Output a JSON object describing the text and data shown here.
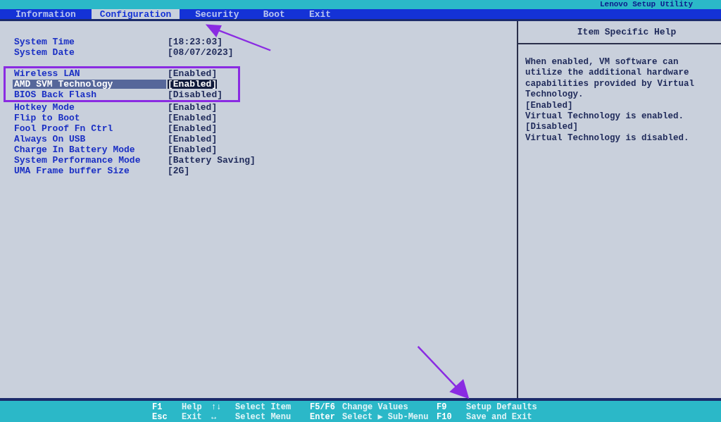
{
  "window": {
    "title": "Lenovo Setup Utility"
  },
  "tabs": [
    {
      "label": "Information",
      "selected": false
    },
    {
      "label": "Configuration",
      "selected": true
    },
    {
      "label": "Security",
      "selected": false
    },
    {
      "label": "Boot",
      "selected": false
    },
    {
      "label": "Exit",
      "selected": false
    }
  ],
  "settings": [
    [
      {
        "label": "System Time",
        "value": "[18:23:03]",
        "selected": false
      },
      {
        "label": "System Date",
        "value": "[08/07/2023]",
        "selected": false
      }
    ],
    [
      {
        "label": "Wireless LAN",
        "value": "[Enabled]",
        "selected": false
      },
      {
        "label": "AMD SVM Technology",
        "value": "[Enabled]",
        "selected": true
      },
      {
        "label": "BIOS Back Flash",
        "value": "[Disabled]",
        "selected": false
      },
      {
        "label": "Hotkey Mode",
        "value": "[Enabled]",
        "selected": false
      },
      {
        "label": "Flip to Boot",
        "value": "[Enabled]",
        "selected": false
      },
      {
        "label": "Fool Proof Fn Ctrl",
        "value": "[Enabled]",
        "selected": false
      },
      {
        "label": "Always On USB",
        "value": "[Enabled]",
        "selected": false
      },
      {
        "label": "Charge In Battery Mode",
        "value": "[Enabled]",
        "selected": false
      },
      {
        "label": "System Performance Mode",
        "value": "[Battery Saving]",
        "selected": false
      },
      {
        "label": "UMA Frame buffer Size",
        "value": "[2G]",
        "selected": false
      }
    ]
  ],
  "help": {
    "title": "Item Specific Help",
    "lines": [
      "When enabled, VM software can",
      "utilize the additional hardware",
      "capabilities provided by Virtual",
      "Technology.",
      "[Enabled]",
      "Virtual Technology is enabled.",
      "[Disabled]",
      "Virtual Technology is disabled."
    ]
  },
  "key_help": [
    [
      {
        "key": "F1",
        "action": "Help"
      },
      {
        "key": "↑↓",
        "action": "Select Item"
      },
      {
        "key": "F5/F6",
        "action": "Change Values"
      },
      {
        "key": "F9",
        "action": "Setup Defaults"
      }
    ],
    [
      {
        "key": "Esc",
        "action": "Exit"
      },
      {
        "key": "↔",
        "action": "Select Menu"
      },
      {
        "key": "Enter",
        "action": "Select ▶ Sub-Menu"
      },
      {
        "key": "F10",
        "action": "Save and Exit"
      }
    ]
  ]
}
